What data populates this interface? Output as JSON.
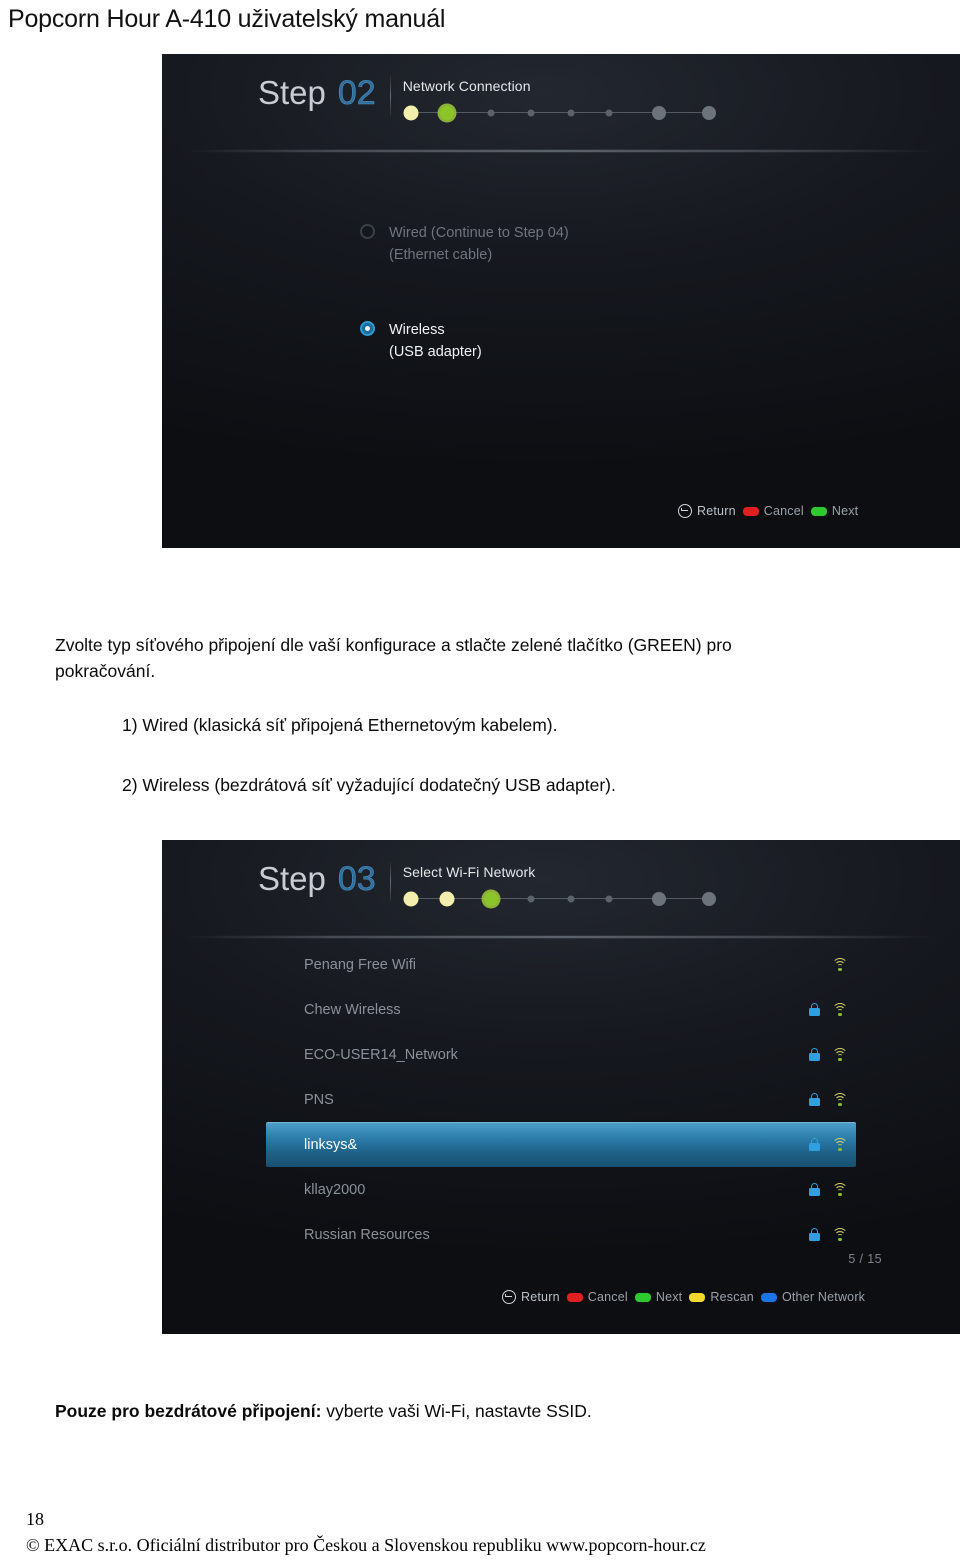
{
  "document": {
    "title": "Popcorn Hour A-410 uživatelský manuál",
    "page_number": "18",
    "footer": "© EXAC s.r.o. Oficiální distributor pro Českou a Slovenskou republiku  www.popcorn-hour.cz"
  },
  "screenshot_step02": {
    "step_word": "Step",
    "step_number": "02",
    "caption": "Network Connection",
    "progress_dots": [
      {
        "state": "done"
      },
      {
        "state": "active"
      },
      {
        "state": "small"
      },
      {
        "state": "small"
      },
      {
        "state": "small"
      },
      {
        "state": "small"
      },
      {
        "state": "big"
      },
      {
        "state": "big"
      }
    ],
    "options": [
      {
        "line1": "Wired (Continue to Step 04)",
        "line2": "(Ethernet cable)",
        "selected": false
      },
      {
        "line1": "Wireless",
        "line2": "(USB adapter)",
        "selected": true
      }
    ],
    "actions": [
      {
        "label": "Return",
        "glyph": "return-icon",
        "color": ""
      },
      {
        "label": "Cancel",
        "glyph": "swatch",
        "color": "#e02020"
      },
      {
        "label": "Next",
        "glyph": "swatch",
        "color": "#2ec92e"
      }
    ]
  },
  "screenshot_step03": {
    "step_word": "Step",
    "step_number": "03",
    "caption": "Select Wi-Fi Network",
    "progress_dots": [
      {
        "state": "done"
      },
      {
        "state": "done"
      },
      {
        "state": "active"
      },
      {
        "state": "small"
      },
      {
        "state": "small"
      },
      {
        "state": "small"
      },
      {
        "state": "big"
      },
      {
        "state": "big"
      }
    ],
    "networks": [
      {
        "ssid": "Penang Free Wifi",
        "locked": false,
        "selected": false
      },
      {
        "ssid": "Chew Wireless",
        "locked": true,
        "selected": false
      },
      {
        "ssid": "ECO-USER14_Network",
        "locked": true,
        "selected": false
      },
      {
        "ssid": "PNS",
        "locked": true,
        "selected": false
      },
      {
        "ssid": "linksys&",
        "locked": true,
        "selected": true
      },
      {
        "ssid": "kllay2000",
        "locked": true,
        "selected": false
      },
      {
        "ssid": "Russian Resources",
        "locked": true,
        "selected": false
      }
    ],
    "pager": "5 / 15",
    "actions": [
      {
        "label": "Return",
        "glyph": "return-icon",
        "color": ""
      },
      {
        "label": "Cancel",
        "glyph": "swatch",
        "color": "#e02020"
      },
      {
        "label": "Next",
        "glyph": "swatch",
        "color": "#2ec92e"
      },
      {
        "label": "Rescan",
        "glyph": "swatch",
        "color": "#f2d72e"
      },
      {
        "label": "Other Network",
        "glyph": "swatch",
        "color": "#1a74e8"
      }
    ]
  },
  "body": {
    "para1": "Zvolte typ síťového připojení dle vaší konfigurace a stlačte zelené tlačítko (GREEN) pro pokračování.",
    "item1": "1) Wired (klasická síť připojená Ethernetovým kabelem).",
    "item2": "2) Wireless (bezdrátová síť vyžadující dodatečný USB adapter).",
    "para2_bold": "Pouze pro bezdrátové připojení:",
    "para2_rest": " vyberte vaši Wi-Fi, nastavte SSID."
  }
}
